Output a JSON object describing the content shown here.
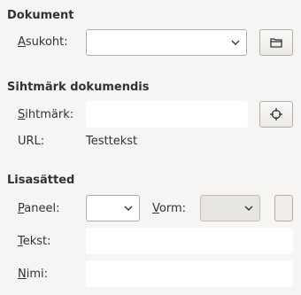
{
  "document": {
    "heading": "Dokument",
    "location_label_mn": "A",
    "location_label_rest": "sukoht:",
    "location_value": ""
  },
  "target": {
    "heading": "Sihtmärk dokumendis",
    "target_label_mn": "S",
    "target_label_rest": "ihtmärk:",
    "target_value": "",
    "url_label": "URL:",
    "url_value": "Testtekst"
  },
  "further": {
    "heading": "Lisasätted",
    "frame_label_mn": "P",
    "frame_label_rest": "aneel:",
    "frame_value": "",
    "form_label_mn": "V",
    "form_label_rest": "orm:",
    "form_value": "",
    "text_label_mn": "T",
    "text_label_rest": "ekst:",
    "text_value": "",
    "name_label_mn": "N",
    "name_label_rest": "imi:",
    "name_value": ""
  },
  "icons": {
    "open_file": "folder-icon",
    "target": "crosshair-icon",
    "dropdown": "chevron-down-icon"
  }
}
